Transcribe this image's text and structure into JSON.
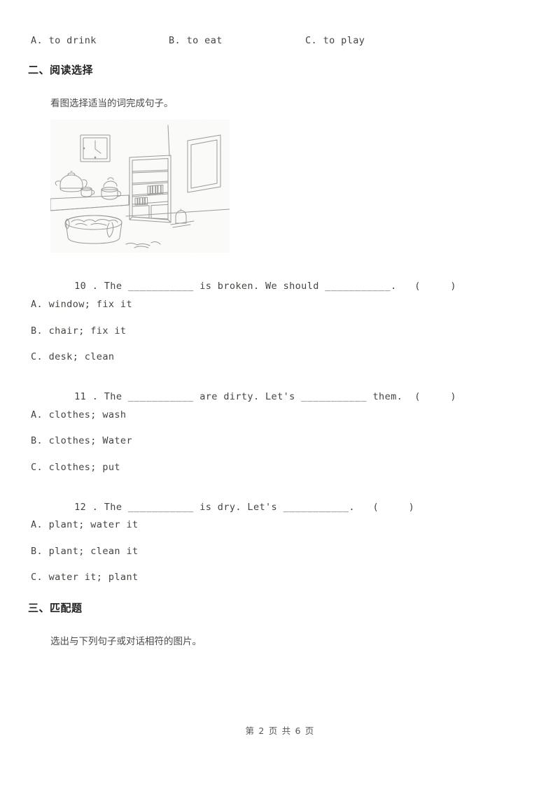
{
  "document": {
    "type": "exam-worksheet",
    "page_background": "#ffffff",
    "text_color": "#44443f"
  },
  "top_options": {
    "a": "A. to drink",
    "b": "B. to eat",
    "c": "C. to play"
  },
  "section_two": {
    "heading": "二、阅读选择",
    "instruction": "看图选择适当的词完成句子。",
    "figure": {
      "alt_name": "room-line-drawing",
      "description": "Line drawing of a room with a wall clock, teapot and cups on a counter, a bookshelf with books, a window, and a basin of clothes on the floor."
    },
    "questions": [
      {
        "number": "10",
        "stem": "10 . The ___________ is broken. We should ___________.   (     )",
        "options": [
          "A. window; fix it",
          "B. chair; fix it",
          "C. desk; clean"
        ]
      },
      {
        "number": "11",
        "stem": "11 . The ___________ are dirty. Let's ___________ them.  (     )",
        "options": [
          "A. clothes; wash",
          "B. clothes; Water",
          "C. clothes; put"
        ]
      },
      {
        "number": "12",
        "stem": "12 . The ___________ is dry. Let's ___________.   (     )",
        "options": [
          "A. plant; water it",
          "B. plant; clean it",
          "C. water it; plant"
        ]
      }
    ]
  },
  "section_three": {
    "heading": "三、匹配题",
    "instruction": "选出与下列句子或对话相符的图片。"
  },
  "footer": {
    "text": "第 2 页 共 6 页",
    "current_page": "2",
    "total_pages": "6"
  }
}
